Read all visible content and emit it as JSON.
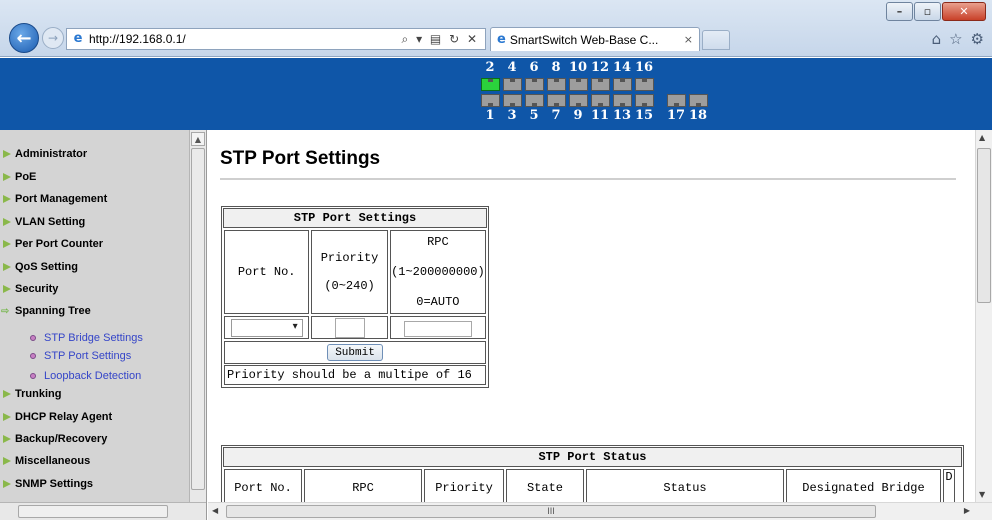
{
  "browser": {
    "url": "http://192.168.0.1/",
    "addr_icons": "⌕ ▾ ▤ ↻ ✕",
    "tab_title": "SmartSwitch Web-Base C...",
    "tab_close": "×",
    "back_icon": "arrow-left-icon",
    "forward_icon": "arrow-right-icon",
    "right_icons": [
      "home-icon",
      "star-icon",
      "gear-icon"
    ],
    "window_controls": [
      "minimize-icon",
      "maximize-icon",
      "close-icon"
    ]
  },
  "banner": {
    "bg_color": "#0f56a8",
    "top_port_labels": [
      "2",
      "4",
      "6",
      "8",
      "10",
      "12",
      "14",
      "16"
    ],
    "bottom_port_labels": [
      "1",
      "3",
      "5",
      "7",
      "9",
      "11",
      "13",
      "15",
      "17",
      "18"
    ],
    "active_port": "2",
    "active_color": "#2bd23c"
  },
  "sidebar": {
    "items": [
      {
        "label": "Administrator"
      },
      {
        "label": "PoE"
      },
      {
        "label": "Port Management"
      },
      {
        "label": "VLAN Setting"
      },
      {
        "label": "Per Port Counter"
      },
      {
        "label": "QoS Setting"
      },
      {
        "label": "Security"
      },
      {
        "label": "Spanning Tree",
        "expanded": true
      },
      {
        "label": "Trunking"
      },
      {
        "label": "DHCP Relay Agent"
      },
      {
        "label": "Backup/Recovery"
      },
      {
        "label": "Miscellaneous"
      },
      {
        "label": "SNMP Settings"
      }
    ],
    "subitems": [
      {
        "label": "STP Bridge Settings"
      },
      {
        "label": "STP Port Settings"
      },
      {
        "label": "Loopback Detection"
      }
    ],
    "link_color": "#3545c8"
  },
  "main": {
    "page_title": "STP Port Settings",
    "settings_table": {
      "title": "STP Port Settings",
      "col_port": "Port No.",
      "col_priority_line1": "Priority",
      "col_priority_line2": "(0~240)",
      "col_rpc_line1": "RPC",
      "col_rpc_line2": "(1~200000000)",
      "col_rpc_line3": "0=AUTO",
      "port_select_value": "",
      "priority_value": "",
      "rpc_value": "",
      "submit_label": "Submit",
      "note": "Priority should be a multipe of 16"
    },
    "status_table": {
      "title": "STP Port Status",
      "columns": [
        "Port No.",
        "RPC",
        "Priority",
        "State",
        "Status",
        "Designated Bridge",
        "D"
      ]
    },
    "hscroll_mark": "III"
  }
}
